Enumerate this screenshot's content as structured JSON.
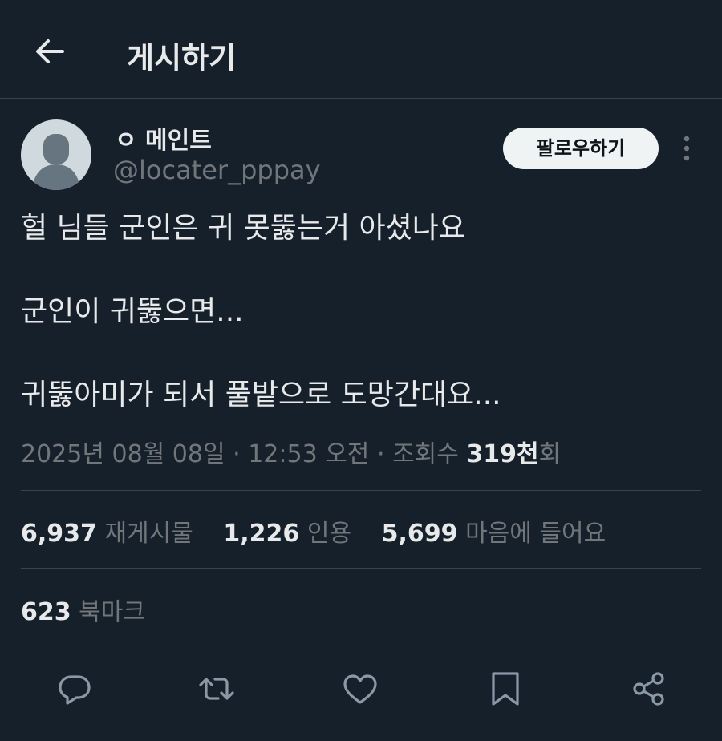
{
  "header": {
    "title": "게시하기",
    "back_icon": "arrow-left-icon"
  },
  "author": {
    "display_name": "ㅇ 메인트",
    "handle": "@locater_pppay",
    "avatar_icon": "default-avatar-icon"
  },
  "follow_button": {
    "label": "팔로우하기"
  },
  "more_icon": "more-vertical-icon",
  "tweet": {
    "lines": [
      "헐 님들 군인은 귀 못뚫는거 아셨나요",
      "",
      "군인이 귀뚫으면...",
      "",
      "귀뚫아미가 되서 풀밭으로 도망간대요..."
    ]
  },
  "meta": {
    "date": "2025년 08월 08일",
    "separator": "·",
    "time": "12:53 오전",
    "views_label": "조회수",
    "views_count": "319천",
    "views_suffix": "회"
  },
  "stats": {
    "reposts_count": "6,937",
    "reposts_label": "재게시물",
    "quotes_count": "1,226",
    "quotes_label": "인용",
    "likes_count": "5,699",
    "likes_label": "마음에 들어요",
    "bookmarks_count": "623",
    "bookmarks_label": "북마크"
  },
  "actions": [
    {
      "icon": "reply-icon"
    },
    {
      "icon": "repost-icon"
    },
    {
      "icon": "like-icon"
    },
    {
      "icon": "bookmark-icon"
    },
    {
      "icon": "share-icon"
    }
  ],
  "colors": {
    "background": "#15202b",
    "text_primary": "#e7e9ea",
    "text_secondary": "#71767b",
    "divider": "#38444d",
    "follow_bg": "#eff3f4"
  }
}
